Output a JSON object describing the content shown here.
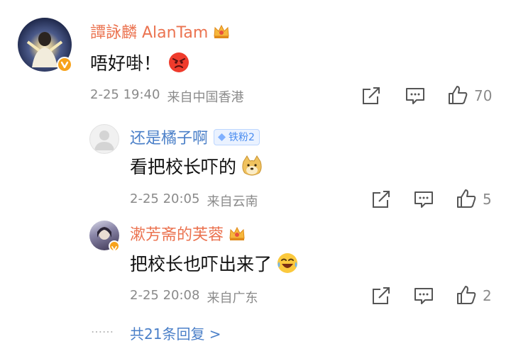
{
  "comment": {
    "author": "譚詠麟 AlanTam",
    "text": "唔好啩！",
    "emoji": "angry-face",
    "date": "2-25 19:40",
    "source": "来自中国香港",
    "likes": "70"
  },
  "replies": [
    {
      "author": "还是橘子啊",
      "badge": "铁粉2",
      "text": "看把校长吓的",
      "emoji": "doge",
      "date": "2-25 20:05",
      "source": "来自云南",
      "likes": "5"
    },
    {
      "author": "漱芳斋的芙蓉",
      "text": "把校长也吓出来了",
      "emoji": "laughing-tears",
      "date": "2-25 20:08",
      "source": "来自广东",
      "likes": "2"
    }
  ],
  "more_replies": {
    "dots": "……",
    "label": "共21条回复 >"
  },
  "colors": {
    "username": "#eb7350",
    "link": "#4a7fc8",
    "meta": "#8a8a8a",
    "fan_badge": "#4a8cf0"
  }
}
